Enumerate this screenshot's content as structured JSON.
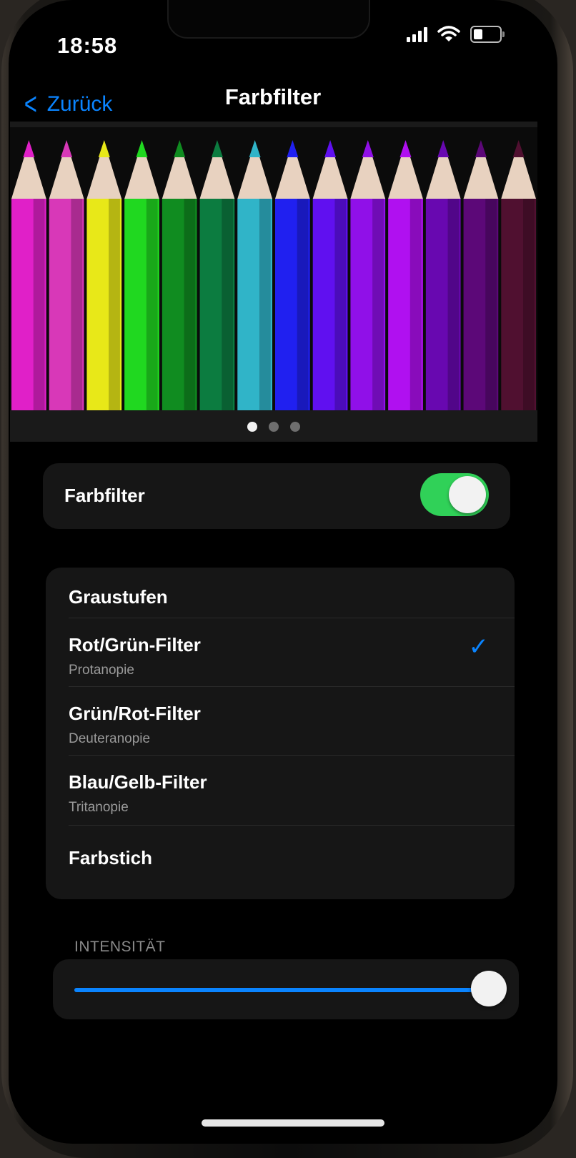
{
  "status_bar": {
    "time": "18:58",
    "icons": [
      "cellular-signal-icon",
      "wifi-icon",
      "battery-icon"
    ]
  },
  "nav": {
    "back_label": "Zurück",
    "title": "Farbfilter"
  },
  "preview": {
    "pencil_colors": [
      "#e020c8",
      "#d838b8",
      "#e8e818",
      "#20d820",
      "#108c20",
      "#0c7c40",
      "#30b4c8",
      "#2020f0",
      "#6010f0",
      "#9010e8",
      "#b010f0",
      "#6808b0",
      "#5c0878",
      "#501030"
    ],
    "page_count": 3,
    "current_page": 1
  },
  "toggle": {
    "label": "Farbfilter",
    "on": true
  },
  "filters": [
    {
      "title": "Graustufen",
      "subtitle": "",
      "selected": false
    },
    {
      "title": "Rot/Grün-Filter",
      "subtitle": "Protanopie",
      "selected": true
    },
    {
      "title": "Grün/Rot-Filter",
      "subtitle": "Deuteranopie",
      "selected": false
    },
    {
      "title": "Blau/Gelb-Filter",
      "subtitle": "Tritanopie",
      "selected": false
    },
    {
      "title": "Farbstich",
      "subtitle": "",
      "selected": false
    }
  ],
  "intensity": {
    "header": "INTENSITÄT",
    "value_fraction": 0.99
  },
  "colors": {
    "accent": "#0a84ff",
    "switch_on": "#30d158"
  }
}
